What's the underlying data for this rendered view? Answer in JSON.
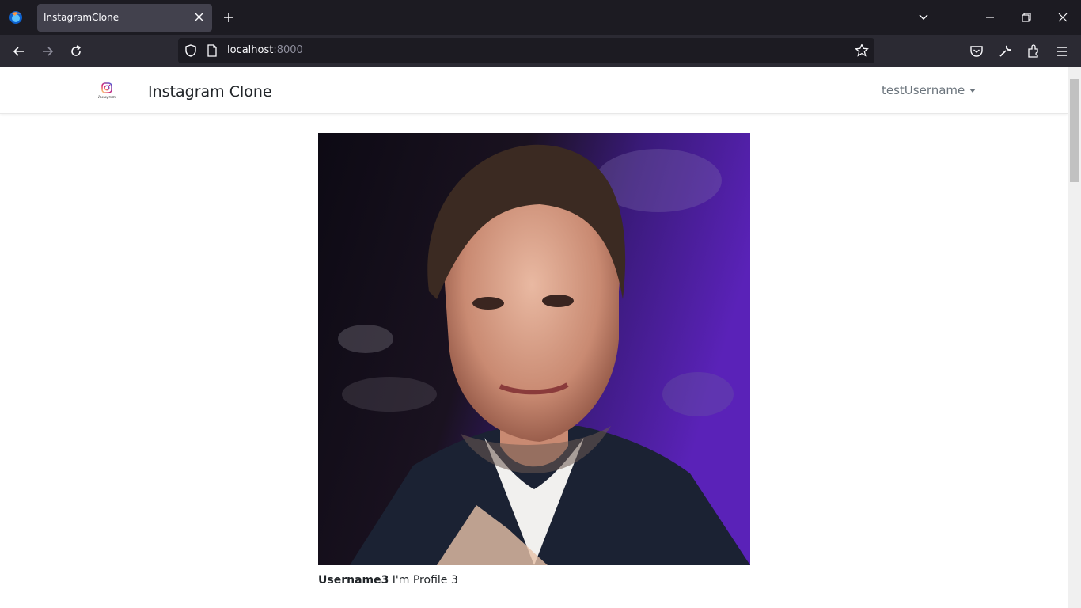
{
  "browser": {
    "tab_title": "InstagramClone",
    "url_host": "localhost",
    "url_port": ":8000"
  },
  "header": {
    "brand_title": "Instagram Clone",
    "logo_text": "Instagram",
    "user_menu_label": "testUsername"
  },
  "post": {
    "username": "Username3",
    "caption": " I'm Profile 3",
    "image_subject": "portrait photo of a man in a dark suit and white shirt against a purple and dark background"
  },
  "icons": [
    "firefox-icon",
    "close-icon",
    "plus-icon",
    "chevron-down-icon",
    "minimize-icon",
    "restore-icon",
    "window-close-icon",
    "back-icon",
    "forward-icon",
    "reload-icon",
    "shield-icon",
    "page-icon",
    "star-icon",
    "pocket-icon",
    "wrench-icon",
    "extensions-icon",
    "menu-icon",
    "instagram-logo-icon",
    "caret-down-icon"
  ],
  "colors": {
    "titlebar": "#1c1b22",
    "navbar": "#2b2a33",
    "active_tab": "#42414d",
    "page_bg": "#ffffff",
    "text_muted": "#6c757d"
  }
}
